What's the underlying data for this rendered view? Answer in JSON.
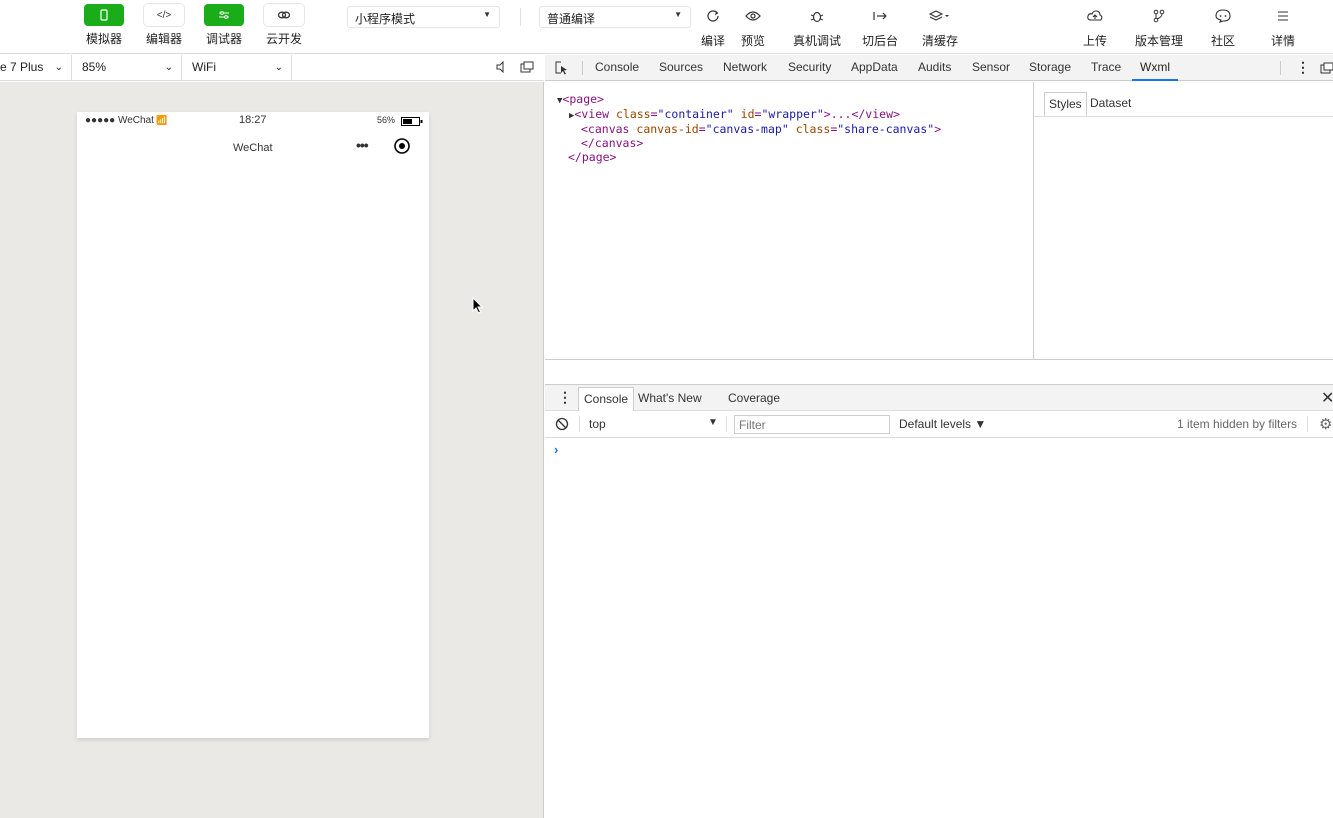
{
  "toolbar": {
    "left_buttons": [
      {
        "label": "模拟器",
        "icon": "phone-icon",
        "active": true
      },
      {
        "label": "编辑器",
        "icon": "code-icon",
        "active": false
      },
      {
        "label": "调试器",
        "icon": "debug-sliders-icon",
        "active": true
      },
      {
        "label": "云开发",
        "icon": "cloud-link-icon",
        "active": false
      }
    ],
    "mode_select": "小程序模式",
    "compile_select": "普通编译",
    "actions": [
      {
        "label": "编译",
        "icon": "refresh-icon"
      },
      {
        "label": "预览",
        "icon": "eye-icon"
      },
      {
        "label": "真机调试",
        "icon": "bug-icon"
      },
      {
        "label": "切后台",
        "icon": "switch-background-icon"
      },
      {
        "label": "清缓存",
        "icon": "layers-icon"
      }
    ],
    "right_actions": [
      {
        "label": "上传",
        "icon": "upload-cloud-icon"
      },
      {
        "label": "版本管理",
        "icon": "branch-icon"
      },
      {
        "label": "社区",
        "icon": "chat-bubble-icon"
      },
      {
        "label": "详情",
        "icon": "menu-lines-icon"
      }
    ]
  },
  "simulator": {
    "device": "e 7 Plus",
    "zoom": "85%",
    "network": "WiFi",
    "status_bar": {
      "carrier": "●●●●● WeChat",
      "time": "18:27",
      "battery": "56%"
    },
    "nav_title": "WeChat"
  },
  "devtools": {
    "tabs": [
      "Console",
      "Sources",
      "Network",
      "Security",
      "AppData",
      "Audits",
      "Sensor",
      "Storage",
      "Trace",
      "Wxml"
    ],
    "active_tab": "Wxml",
    "wxml": {
      "l1_tag": "<page>",
      "l2_open": "<view",
      "l2_attr1": "class",
      "l2_val1": "\"container\"",
      "l2_attr2": "id",
      "l2_val2": "\"wrapper\"",
      "l2_close": ">...</view>",
      "l3_open": "<canvas",
      "l3_attr1": "canvas-id",
      "l3_val1": "\"canvas-map\"",
      "l3_attr2": "class",
      "l3_val2": "\"share-canvas\"",
      "l3_close": ">",
      "l4": "</canvas>",
      "l5": "</page>",
      "eq": "="
    },
    "side_tabs": [
      "Styles",
      "Dataset"
    ],
    "drawer_tabs": [
      "Console",
      "What's New",
      "Coverage"
    ],
    "console": {
      "context": "top",
      "filter_placeholder": "Filter",
      "levels": "Default levels ▼",
      "hidden_info": "1 item hidden by filters",
      "prompt": "›"
    }
  }
}
